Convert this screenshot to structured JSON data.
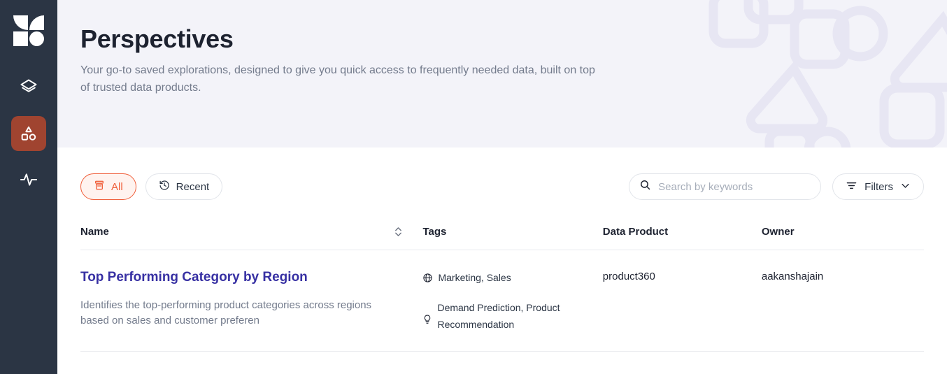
{
  "brand": {
    "logo_name": "app-logo",
    "accent_color": "#f0603c",
    "sidebar_bg": "#2b3544",
    "active_nav_bg": "#a04430",
    "link_color": "#3730a3"
  },
  "sidebar": {
    "items": [
      {
        "icon": "layers-icon",
        "name": "sidebar-item-data-products",
        "active": false
      },
      {
        "icon": "shapes-icon",
        "name": "sidebar-item-perspectives",
        "active": true
      },
      {
        "icon": "activity-icon",
        "name": "sidebar-item-monitoring",
        "active": false
      }
    ]
  },
  "hero": {
    "title": "Perspectives",
    "subtitle": "Your go-to saved explorations, designed to give you quick access to frequently needed data, built on top of trusted data products."
  },
  "toolbar": {
    "chips": [
      {
        "label": "All",
        "icon": "archive-icon",
        "selected": true
      },
      {
        "label": "Recent",
        "icon": "history-icon",
        "selected": false
      }
    ],
    "search": {
      "placeholder": "Search by keywords",
      "value": "",
      "icon": "search-icon"
    },
    "filters": {
      "label": "Filters",
      "icon": "filter-icon",
      "chevron": "chevron-down-icon"
    }
  },
  "table": {
    "columns": [
      {
        "label": "Name",
        "sortable": true
      },
      {
        "label": "Tags",
        "sortable": false
      },
      {
        "label": "Data Product",
        "sortable": false
      },
      {
        "label": "Owner",
        "sortable": false
      }
    ],
    "rows": [
      {
        "title": "Top Performing Category by Region",
        "description": "Identifies the top-performing product categories across regions based on sales and customer preferen",
        "tags": [
          {
            "icon": "globe-icon",
            "text": "Marketing, Sales"
          },
          {
            "icon": "lightbulb-icon",
            "text": "Demand Prediction, Product Recommendation"
          }
        ],
        "data_product": "product360",
        "owner": "aakanshajain"
      }
    ]
  }
}
